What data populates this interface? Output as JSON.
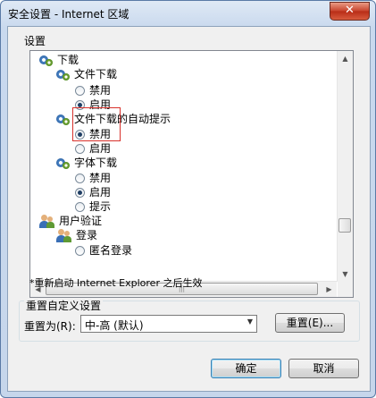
{
  "window": {
    "title": "安全设置 - Internet 区域",
    "close_label": "✕"
  },
  "settings_label": "设置",
  "tree": [
    {
      "kind": "folder",
      "icon": "settings-gear-icon",
      "label": "下载"
    },
    {
      "kind": "setting",
      "icon": "settings-gear-icon",
      "label": "文件下载"
    },
    {
      "kind": "radio",
      "label": "禁用",
      "checked": false
    },
    {
      "kind": "radio",
      "label": "启用",
      "checked": true
    },
    {
      "kind": "setting",
      "icon": "settings-gear-icon",
      "label": "文件下载的自动提示"
    },
    {
      "kind": "radio",
      "label": "禁用",
      "checked": true
    },
    {
      "kind": "radio",
      "label": "启用",
      "checked": false
    },
    {
      "kind": "setting",
      "icon": "settings-gear-icon",
      "label": "字体下载"
    },
    {
      "kind": "radio",
      "label": "禁用",
      "checked": false
    },
    {
      "kind": "radio",
      "label": "启用",
      "checked": true
    },
    {
      "kind": "radio",
      "label": "提示",
      "checked": false
    },
    {
      "kind": "folder",
      "icon": "users-icon",
      "label": "用户验证"
    },
    {
      "kind": "setting",
      "icon": "users-icon",
      "label": "登录"
    },
    {
      "kind": "radio",
      "label": "匿名登录",
      "checked": false
    }
  ],
  "note": "*重新启动 Internet Explorer 之后生效",
  "reset_group": {
    "title": "重置自定义设置",
    "reset_to_label": "重置为(R):",
    "selected_level": "中-高 (默认)",
    "reset_button": "重置(E)..."
  },
  "buttons": {
    "ok": "确定",
    "cancel": "取消"
  },
  "colors": {
    "highlight_border": "#d8312b",
    "title_gradient_top": "#dfe9f5",
    "close_button": "#c7422b"
  }
}
